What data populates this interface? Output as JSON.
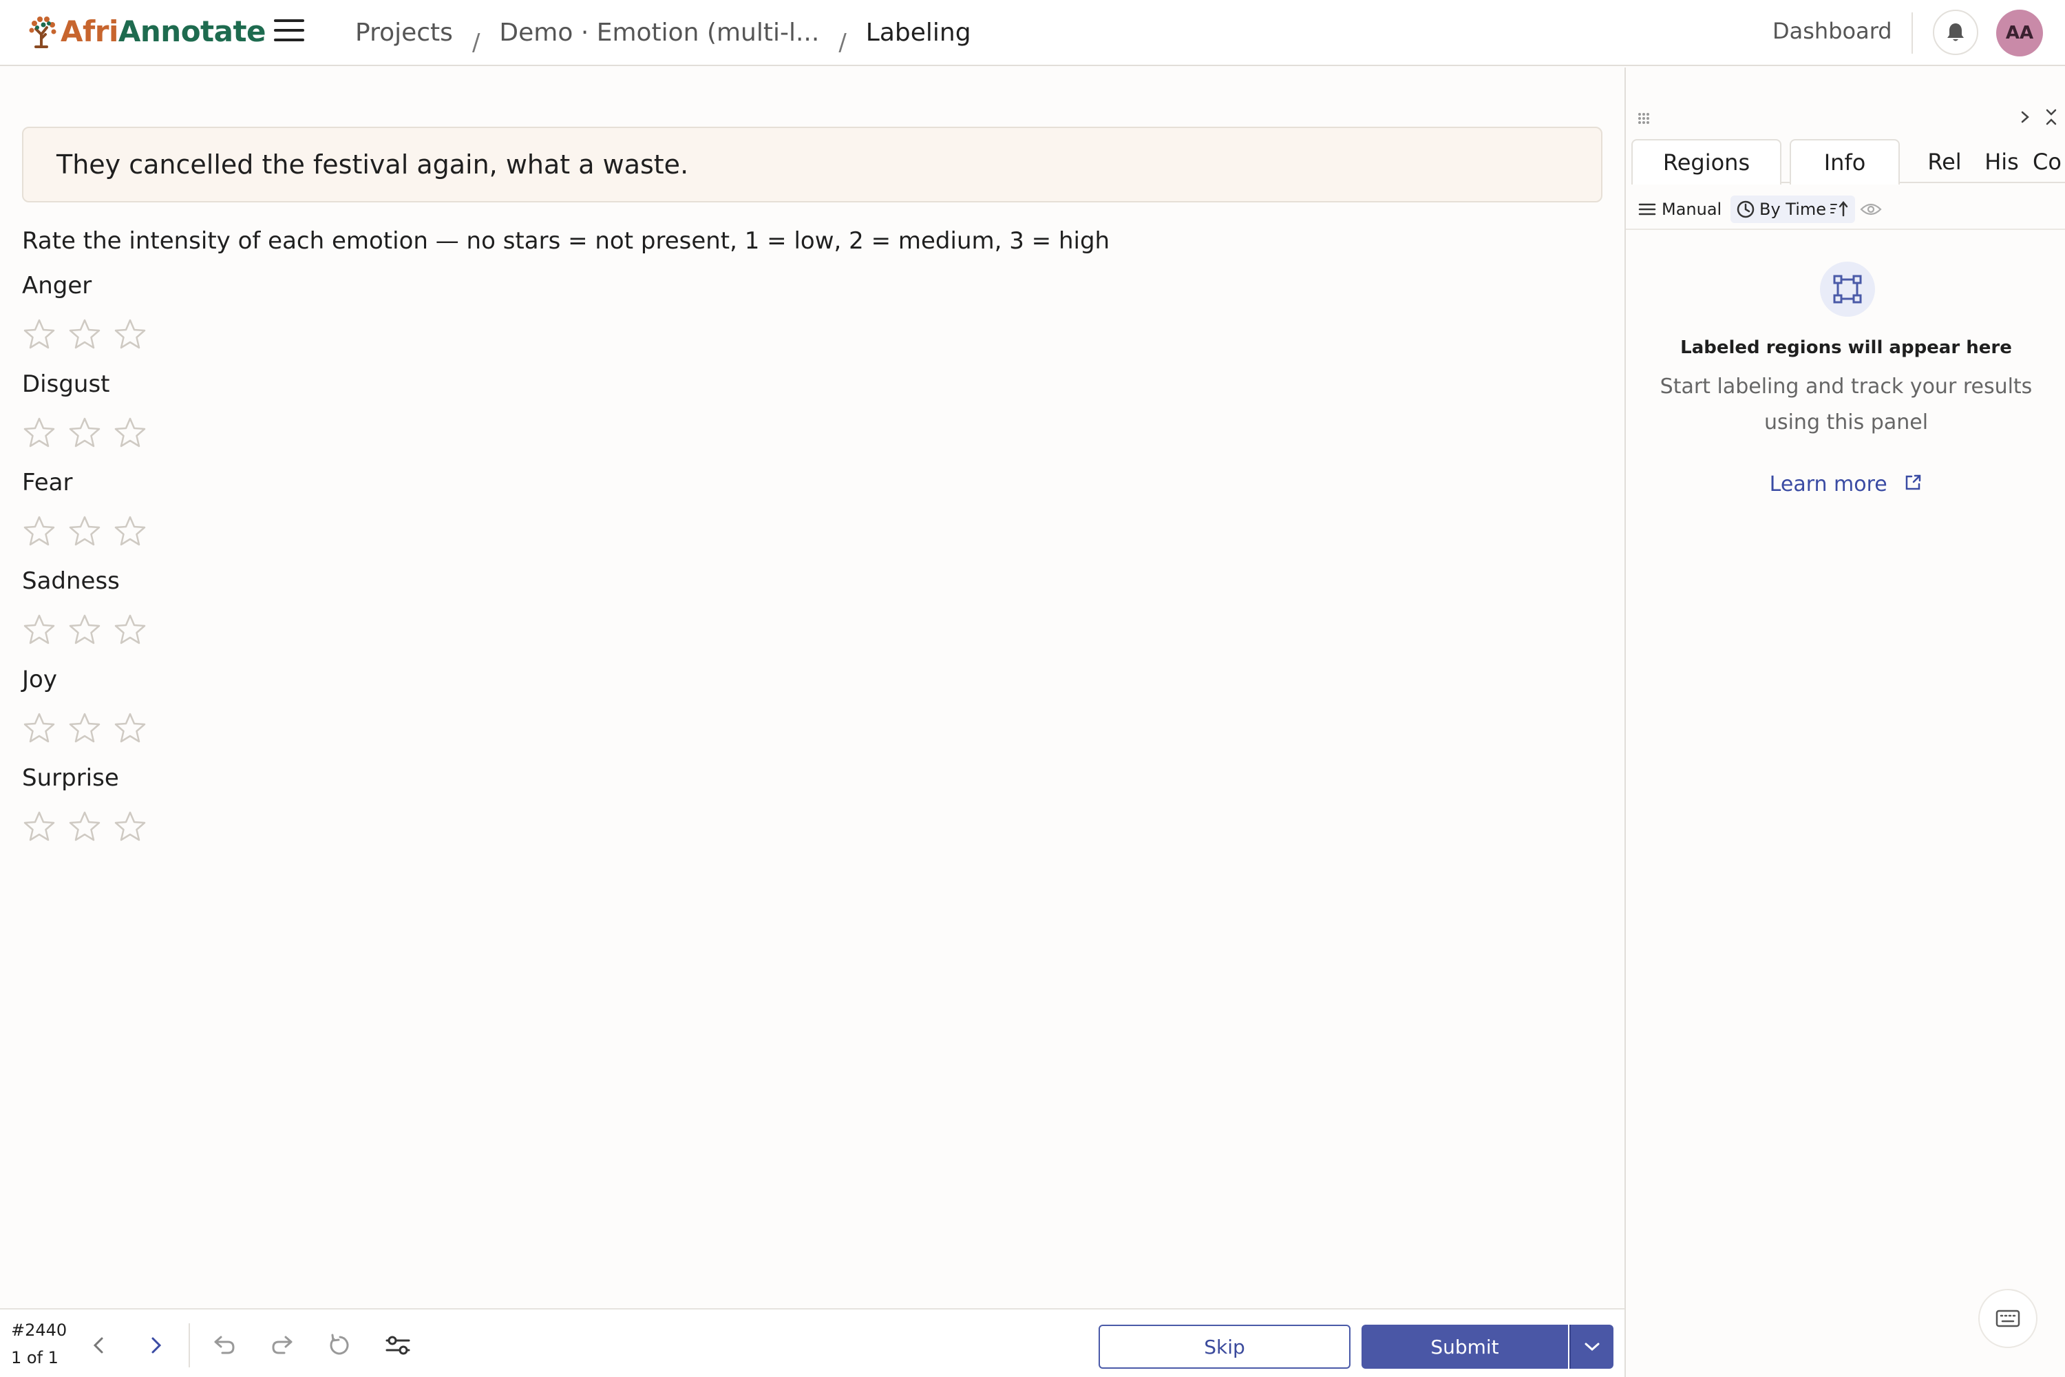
{
  "app": {
    "logo_part1": "Afri",
    "logo_part2": "Annotate",
    "brand_colors": {
      "afri": "#c7652e",
      "annotate": "#1e6b4f",
      "accent": "#4a57a6"
    }
  },
  "header": {
    "breadcrumbs": [
      "Projects",
      "Demo · Emotion (multi-l...",
      "Labeling"
    ],
    "separator": "/",
    "dashboard_label": "Dashboard",
    "avatar_initials": "AA",
    "icons": [
      "menu-icon",
      "bell-icon"
    ]
  },
  "task": {
    "text": "They cancelled the festival again, what a waste.",
    "instructions": "Rate the intensity of each emotion — no stars = not present, 1 = low, 2 = medium, 3 = high",
    "emotions": [
      {
        "label": "Anger",
        "rating": 0,
        "max": 3
      },
      {
        "label": "Disgust",
        "rating": 0,
        "max": 3
      },
      {
        "label": "Fear",
        "rating": 0,
        "max": 3
      },
      {
        "label": "Sadness",
        "rating": 0,
        "max": 3
      },
      {
        "label": "Joy",
        "rating": 0,
        "max": 3
      },
      {
        "label": "Surprise",
        "rating": 0,
        "max": 3
      }
    ]
  },
  "bottom_bar": {
    "task_id": "#2440",
    "task_count": "1 of 1",
    "skip_label": "Skip",
    "submit_label": "Submit",
    "icons": [
      "chevron-left-icon",
      "chevron-right-icon",
      "undo-icon",
      "redo-icon",
      "reset-icon",
      "settings-sliders-icon",
      "chevron-down-icon"
    ]
  },
  "side_panel": {
    "tabs": [
      "Regions",
      "Info",
      "Rel",
      "His",
      "Co"
    ],
    "toolbar": {
      "manual_label": "Manual",
      "by_time_label": "By Time"
    },
    "empty_title": "Labeled regions will appear here",
    "empty_subtitle": "Start labeling and track your results using this panel",
    "learn_more_label": "Learn more",
    "icons": [
      "drag-handle-icon",
      "expand-icon",
      "collapse-icon",
      "region-icon",
      "external-link-icon",
      "eye-icon",
      "clock-icon",
      "sort-icon",
      "list-icon",
      "keyboard-icon"
    ]
  }
}
